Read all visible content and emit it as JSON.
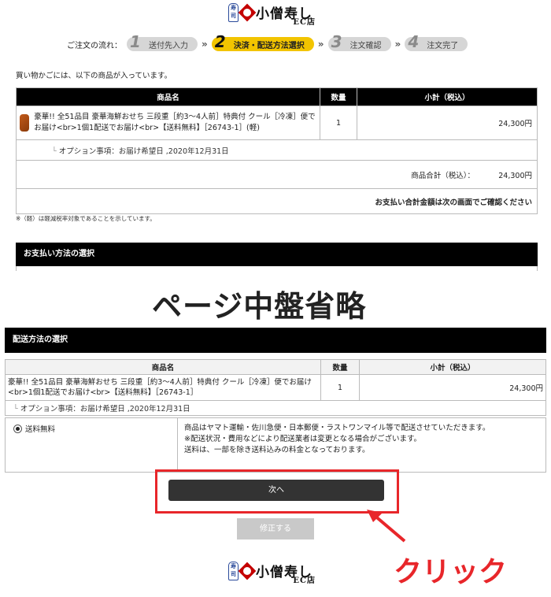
{
  "logo": {
    "badge": "寿司",
    "name": "小僧寿し",
    "sub": "EC店"
  },
  "flow": {
    "label": "ご注文の流れ：",
    "steps": [
      {
        "num": "1",
        "label": "送付先入力"
      },
      {
        "num": "2",
        "label": "決済・配送方法選択"
      },
      {
        "num": "3",
        "label": "注文確認"
      },
      {
        "num": "4",
        "label": "注文完了"
      }
    ],
    "separator": "»"
  },
  "cart": {
    "intro": "買い物かごには、以下の商品が入っています。",
    "headers": [
      "商品名",
      "数量",
      "小計（税込）"
    ],
    "item": {
      "name": "豪華!! 全51品目 豪華海鮮おせち 三段重［約3〜4人前］特典付 クール［冷凍］便でお届け<br>1個1配送でお届け<br>【送料無料】［26743-1］(軽)",
      "qty": "1",
      "subtotal": "24,300円"
    },
    "option": "オプション事項：お届け希望日 ,2020年12月31日",
    "total_label": "商品合計（税込）：",
    "total_value": "24,300円",
    "notice": "お支払い合計金額は次の画面でご確認ください",
    "footnote": "※（軽）は軽減税率対象であることを示しています。"
  },
  "payment": {
    "title": "お支払い方法の選択"
  },
  "overlay": {
    "omitted": "ページ中盤省略",
    "click": "クリック"
  },
  "shipping": {
    "title": "配送方法の選択",
    "headers": [
      "商品名",
      "数量",
      "小計（税込）"
    ],
    "item": {
      "name": "豪華!! 全51品目 豪華海鮮おせち 三段重［約3〜4人前］特典付 クール［冷凍］便でお届け<br>1個1配送でお届け<br>【送料無料】［26743-1］",
      "qty": "1",
      "subtotal": "24,300円"
    },
    "option": "オプション事項：お届け希望日 ,2020年12月31日",
    "method": "送料無料",
    "desc": [
      "商品はヤマト運輸・佐川急便・日本郵便・ラストワンマイル等で配送させていただきます。",
      "※配送状況・費用などにより配送業者は変更となる場合がございます。",
      "送料は、一部を除き送料込みの料金となっております。"
    ]
  },
  "buttons": {
    "next": "次へ",
    "fix": "修正する"
  },
  "colors": {
    "accent_yellow": "#f2c400",
    "brand_red": "#c40000",
    "highlight_red": "#e8262a",
    "header_black": "#000000"
  }
}
